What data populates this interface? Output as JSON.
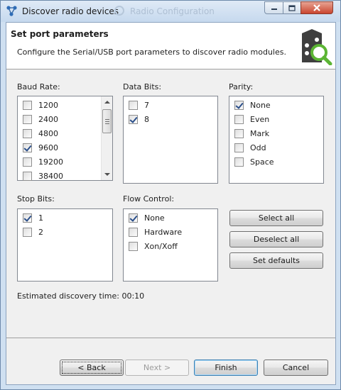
{
  "window": {
    "title": "Discover radio devices",
    "background_title": "Radio Configuration"
  },
  "header": {
    "title": "Set port parameters",
    "description": "Configure the Serial/USB port parameters to discover radio modules.",
    "icon": "radio-module-search-icon"
  },
  "baud_rate": {
    "label": "Baud Rate:",
    "items": [
      {
        "label": "1200",
        "checked": false
      },
      {
        "label": "2400",
        "checked": false
      },
      {
        "label": "4800",
        "checked": false
      },
      {
        "label": "9600",
        "checked": true
      },
      {
        "label": "19200",
        "checked": false
      },
      {
        "label": "38400",
        "checked": false
      }
    ]
  },
  "data_bits": {
    "label": "Data Bits:",
    "items": [
      {
        "label": "7",
        "checked": false
      },
      {
        "label": "8",
        "checked": true
      }
    ]
  },
  "parity": {
    "label": "Parity:",
    "items": [
      {
        "label": "None",
        "checked": true
      },
      {
        "label": "Even",
        "checked": false
      },
      {
        "label": "Mark",
        "checked": false
      },
      {
        "label": "Odd",
        "checked": false
      },
      {
        "label": "Space",
        "checked": false
      }
    ]
  },
  "stop_bits": {
    "label": "Stop Bits:",
    "items": [
      {
        "label": "1",
        "checked": true
      },
      {
        "label": "2",
        "checked": false
      }
    ]
  },
  "flow_control": {
    "label": "Flow Control:",
    "items": [
      {
        "label": "None",
        "checked": true
      },
      {
        "label": "Hardware",
        "checked": false
      },
      {
        "label": "Xon/Xoff",
        "checked": false
      }
    ]
  },
  "actions": {
    "select_all": "Select all",
    "deselect_all": "Deselect all",
    "set_defaults": "Set defaults"
  },
  "estimate": {
    "text": "Estimated discovery time: 00:10"
  },
  "footer": {
    "back": "< Back",
    "next": "Next >",
    "finish": "Finish",
    "cancel": "Cancel"
  },
  "colors": {
    "title_bar": "#c6d9ee",
    "close_button": "#c9452f",
    "check_mark": "#2b4f8a",
    "dialog_bg": "#f0f0f0"
  }
}
